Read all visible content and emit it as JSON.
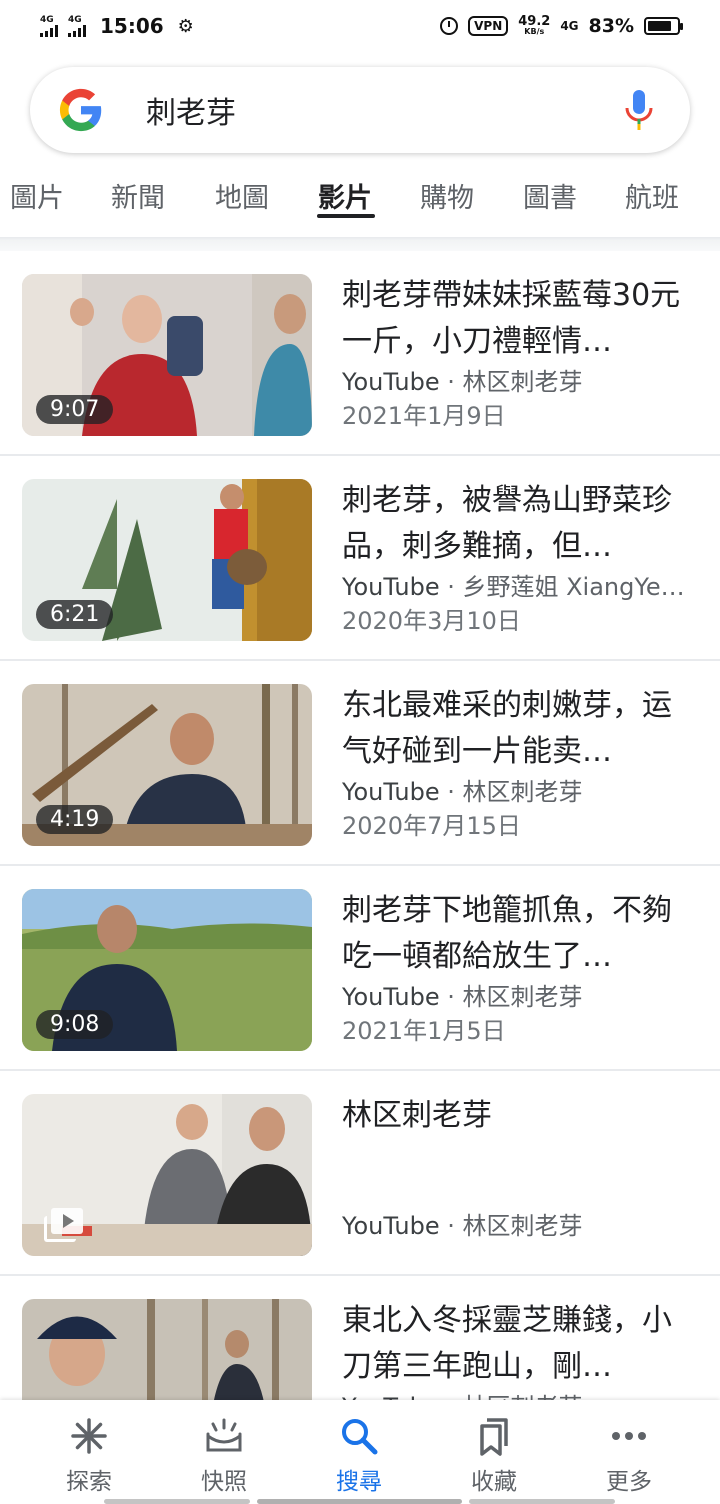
{
  "status_bar": {
    "signal1": "4G",
    "signal2": "4G",
    "time": "15:06",
    "vpn": "VPN",
    "speed": "49.2",
    "speed_unit": "KB/s",
    "network": "4G",
    "battery": "83%",
    "battery_level": 0.83
  },
  "search": {
    "query": "刺老芽",
    "logo": "google-logo",
    "mic_icon": "mic-icon"
  },
  "tabs": [
    {
      "label": "圖片"
    },
    {
      "label": "新聞"
    },
    {
      "label": "地圖"
    },
    {
      "label": "影片",
      "active": true
    },
    {
      "label": "購物"
    },
    {
      "label": "圖書"
    },
    {
      "label": "航班"
    }
  ],
  "results": [
    {
      "title": "刺老芽帶妹妹採藍莓30元一斤，小刀禮輕情…",
      "source": "YouTube",
      "channel": " · 林区刺老芽",
      "date": "2021年1月9日",
      "duration": "9:07",
      "thumb_colors": [
        "#d9d3cf",
        "#b9282e",
        "#3e8aa8",
        "#e8e2db"
      ]
    },
    {
      "title": "刺老芽，被譽為山野菜珍品，刺多難摘，但…",
      "source": "YouTube",
      "channel": " · 乡野莲姐 XiangYe L…",
      "date": "2020年3月10日",
      "duration": "6:21",
      "thumb_colors": [
        "#e7ece9",
        "#5f7d54",
        "#c1902f",
        "#d8262e"
      ]
    },
    {
      "title": "东北最难采的刺嫩芽，运气好碰到一片能卖…",
      "source": "YouTube",
      "channel": " · 林区刺老芽",
      "date": "2020年7月15日",
      "duration": "4:19",
      "thumb_colors": [
        "#cfc6b8",
        "#7a6a4e",
        "#283246",
        "#a08466"
      ]
    },
    {
      "title": "刺老芽下地籠抓魚，不夠吃一頓都給放生了…",
      "source": "YouTube",
      "channel": " · 林区刺老芽",
      "date": "2021年1月5日",
      "duration": "9:08",
      "thumb_colors": [
        "#9cc3e4",
        "#6e8f45",
        "#1f2c44",
        "#a4b66a"
      ]
    },
    {
      "title": "林区刺老芽",
      "source": "YouTube",
      "channel": " · 林区刺老芽",
      "date": "",
      "duration": "",
      "thumb_colors": [
        "#eceae5",
        "#6b6d72",
        "#2b2b2b",
        "#d64a3d"
      ]
    },
    {
      "title": "東北入冬採靈芝賺錢，小刀第三年跑山，剛…",
      "source": "YouTube",
      "channel": " · 林区刺老芽",
      "date": "",
      "duration": "",
      "thumb_colors": [
        "#c7c1b6",
        "#1d2a45",
        "#8a7a64",
        "#d1c4ae"
      ]
    }
  ],
  "bottom_nav": [
    {
      "label": "探索",
      "icon": "asterisk-icon"
    },
    {
      "label": "快照",
      "icon": "snapshot-icon"
    },
    {
      "label": "搜尋",
      "icon": "search-icon",
      "active": true
    },
    {
      "label": "收藏",
      "icon": "collections-icon"
    },
    {
      "label": "更多",
      "icon": "more-icon"
    }
  ],
  "colors": {
    "accent": "#1a73e8",
    "text": "#202124",
    "secondary": "#5f6368"
  }
}
